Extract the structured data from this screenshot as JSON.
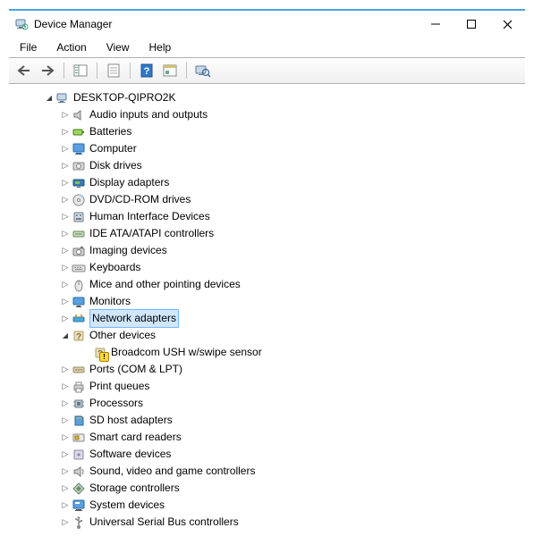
{
  "window": {
    "title": "Device Manager"
  },
  "menu": {
    "file": "File",
    "action": "Action",
    "view": "View",
    "help": "Help"
  },
  "tree": {
    "root": "DESKTOP-QIPRO2K",
    "nodes": [
      {
        "label": "Audio inputs and outputs",
        "icon": "speaker"
      },
      {
        "label": "Batteries",
        "icon": "battery"
      },
      {
        "label": "Computer",
        "icon": "computer"
      },
      {
        "label": "Disk drives",
        "icon": "disk"
      },
      {
        "label": "Display adapters",
        "icon": "display"
      },
      {
        "label": "DVD/CD-ROM drives",
        "icon": "cdrom"
      },
      {
        "label": "Human Interface Devices",
        "icon": "hid"
      },
      {
        "label": "IDE ATA/ATAPI controllers",
        "icon": "ide"
      },
      {
        "label": "Imaging devices",
        "icon": "camera"
      },
      {
        "label": "Keyboards",
        "icon": "keyboard"
      },
      {
        "label": "Mice and other pointing devices",
        "icon": "mouse"
      },
      {
        "label": "Monitors",
        "icon": "monitor"
      },
      {
        "label": "Network adapters",
        "icon": "network",
        "selected": true
      },
      {
        "label": "Other devices",
        "icon": "other",
        "expanded": true,
        "children": [
          {
            "label": "Broadcom USH w/swipe sensor",
            "icon": "other-warn"
          }
        ]
      },
      {
        "label": "Ports (COM & LPT)",
        "icon": "port"
      },
      {
        "label": "Print queues",
        "icon": "printer"
      },
      {
        "label": "Processors",
        "icon": "cpu"
      },
      {
        "label": "SD host adapters",
        "icon": "sd"
      },
      {
        "label": "Smart card readers",
        "icon": "smartcard"
      },
      {
        "label": "Software devices",
        "icon": "software"
      },
      {
        "label": "Sound, video and game controllers",
        "icon": "sound"
      },
      {
        "label": "Storage controllers",
        "icon": "storage"
      },
      {
        "label": "System devices",
        "icon": "system"
      },
      {
        "label": "Universal Serial Bus controllers",
        "icon": "usb"
      }
    ]
  }
}
